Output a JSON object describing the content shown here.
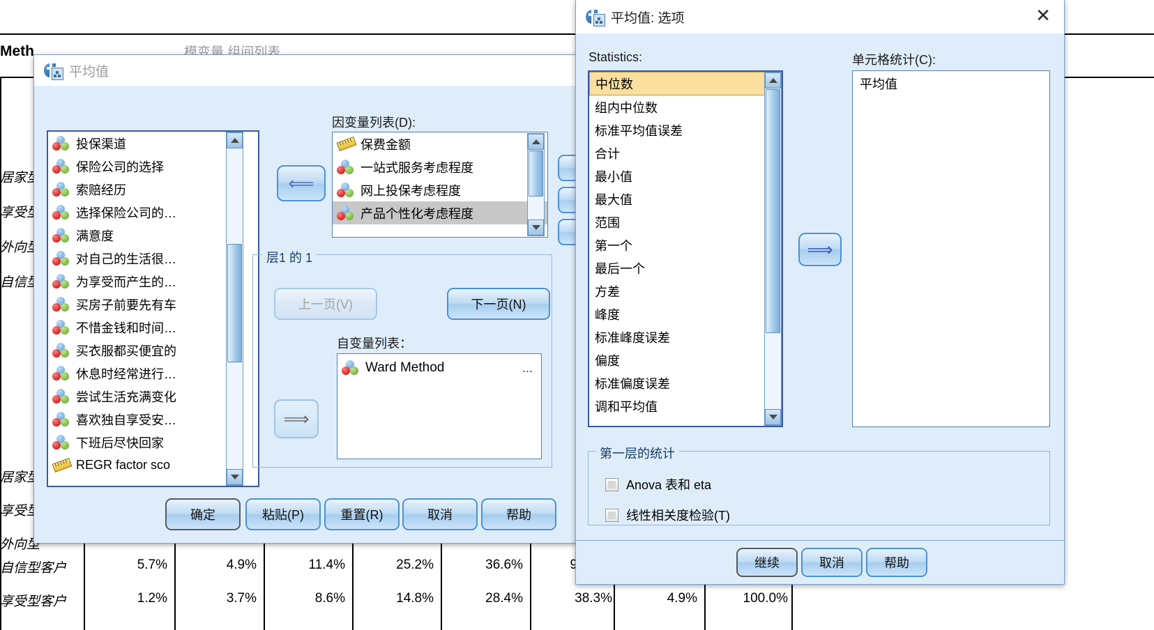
{
  "background": {
    "heading": "Meth",
    "faded_title": "…模变量 组间列表",
    "row_labels": [
      "居家型",
      "享受型",
      "外向型",
      "自信型",
      "享受型",
      "自信型客户",
      "享受型客户"
    ],
    "table_rows": [
      {
        "label": "自信型客户",
        "cells": [
          "5.7%",
          "4.9%",
          "11.4%",
          "25.2%",
          "36.6%",
          "9",
          "",
          ""
        ]
      },
      {
        "label": "享受型客户",
        "cells": [
          "1.2%",
          "3.7%",
          "8.6%",
          "14.8%",
          "28.4%",
          "38.3%",
          "4.9%",
          "100.0%"
        ]
      }
    ]
  },
  "means_dialog": {
    "title": "平均值",
    "icon": "spss-app-icon",
    "source_list": {
      "items": [
        {
          "label": "投保渠道",
          "icon": "nominal-icon"
        },
        {
          "label": "保险公司的选择",
          "icon": "nominal-icon"
        },
        {
          "label": "索赔经历",
          "icon": "nominal-icon"
        },
        {
          "label": "选择保险公司的…",
          "icon": "nominal-icon"
        },
        {
          "label": "满意度",
          "icon": "nominal-icon"
        },
        {
          "label": "对自己的生活很…",
          "icon": "nominal-icon"
        },
        {
          "label": "为享受而产生的…",
          "icon": "nominal-icon"
        },
        {
          "label": "买房子前要先有车",
          "icon": "nominal-icon"
        },
        {
          "label": "不惜金钱和时间…",
          "icon": "nominal-icon"
        },
        {
          "label": "买衣服都买便宜的",
          "icon": "nominal-icon"
        },
        {
          "label": "休息时经常进行…",
          "icon": "nominal-icon"
        },
        {
          "label": "尝试生活充满变化",
          "icon": "nominal-icon"
        },
        {
          "label": "喜欢独自享受安…",
          "icon": "nominal-icon"
        },
        {
          "label": "下班后尽快回家",
          "icon": "nominal-icon"
        },
        {
          "label": "REGR factor sco",
          "icon": "scale-icon"
        }
      ]
    },
    "dependent_label": "因变量列表(D):",
    "dependent_list": {
      "items": [
        {
          "label": "保费金额",
          "icon": "scale-icon",
          "selected": false
        },
        {
          "label": "一站式服务考虑程度",
          "icon": "nominal-icon",
          "selected": false
        },
        {
          "label": "网上投保考虑程度",
          "icon": "nominal-icon",
          "selected": false
        },
        {
          "label": "产品个性化考虑程度",
          "icon": "nominal-icon",
          "selected": true
        }
      ]
    },
    "layer_group_label": "层1 的 1",
    "prev_button": "上一页(V)",
    "next_button": "下一页(N)",
    "independent_label": "自变量列表：",
    "independent_list": {
      "items": [
        {
          "label": "Ward Method",
          "icon": "nominal-icon",
          "trailing": "..."
        }
      ]
    },
    "move_left_icon": "arrow-left-icon",
    "move_right_icon": "arrow-right-icon",
    "buttons": [
      "确定",
      "粘贴(P)",
      "重置(R)",
      "取消",
      "帮助"
    ],
    "side_buttons": [
      "",
      "",
      ""
    ]
  },
  "options_dialog": {
    "title": "平均值: 选项",
    "icon": "spss-app-icon",
    "close_icon": "close-icon",
    "statistics_label": "Statistics:",
    "statistics_items": [
      "中位数",
      "组内中位数",
      "标准平均值误差",
      "合计",
      "最小值",
      "最大值",
      "范围",
      "第一个",
      "最后一个",
      "方差",
      "峰度",
      "标准峰度误差",
      "偏度",
      "标准偏度误差",
      "调和平均值"
    ],
    "statistics_selected": "中位数",
    "cell_label": "单元格统计(C):",
    "cell_items": [
      "平均值"
    ],
    "move_icon": "arrow-right-icon",
    "layer_group_label": "第一层的统计",
    "checkboxes": [
      {
        "label": "Anova 表和 eta",
        "checked": false,
        "mnemonic": "A"
      },
      {
        "label": "线性相关度检验(T)",
        "checked": false,
        "mnemonic": "T"
      }
    ],
    "buttons": [
      "继续",
      "取消",
      "帮助"
    ]
  },
  "colors": {
    "dialog_bg": "#dfedfb",
    "selection_amber": "#fadf9e",
    "selection_gray": "#c8c8c8",
    "border_blue": "#3858a8",
    "button_blue": "#4a93d0"
  }
}
